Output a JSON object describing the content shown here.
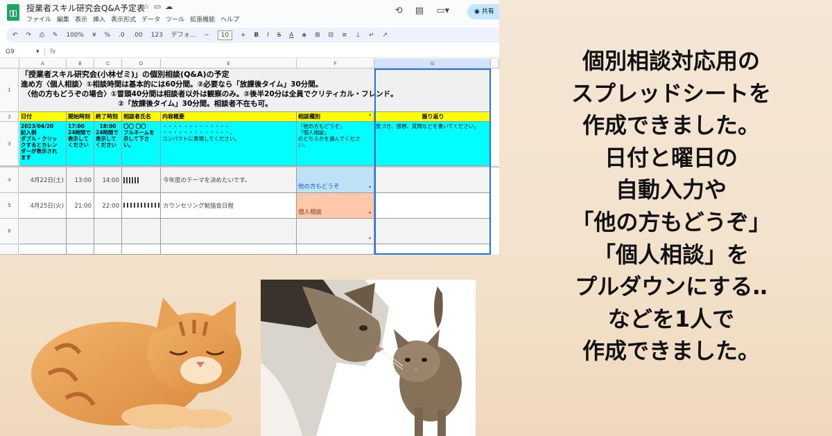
{
  "window": {
    "doc_title": "授業者スキル研究会Q&A予定表",
    "menu": [
      "ファイル",
      "編集",
      "表示",
      "挿入",
      "表示形式",
      "データ",
      "ツール",
      "拡張機能",
      "ヘルプ"
    ],
    "share_label": "共有"
  },
  "toolbar": {
    "zoom": "100%",
    "currency": "¥",
    "percent": "%",
    "dec_less": ".0",
    "dec_more": ".00",
    "number_format": "123",
    "font": "デフォ...",
    "font_size": "10"
  },
  "formula_bar": {
    "cell_ref": "G9",
    "fx": "fx"
  },
  "columns": [
    "A",
    "B",
    "C",
    "D",
    "E",
    "F",
    "G"
  ],
  "rows": [
    "1",
    "2",
    "3",
    "4",
    "5",
    "6"
  ],
  "row1": {
    "line1": "「授業者スキル研究会(小林ゼミ)」の個別相談(Q&A)の予定",
    "line2": "進め方〈個人相談〉①相談時間は基本的には60分間。②必要なら「放課後タイム」30分間。",
    "line3": "〈他の方もどうぞの場合〉①冒頭40分間は相談者以外は観察のみ。②後半20分は全員でクリティカル・フレンド。",
    "line4": "②「放課後タイム」30分間。相談者不在も可。"
  },
  "header_row": {
    "date": "日付",
    "start": "開始時刻",
    "end": "終了時刻",
    "name": "相談者氏名",
    "content": "内容概要",
    "type": "相談種別",
    "reflection": "振り返り"
  },
  "example_row": {
    "date_line1": "2023/04/20",
    "date_line2": "記入例",
    "date_line3": "ダブル・クリッ",
    "date_line4": "クするとカレン",
    "date_line5": "ダーが表示され",
    "date_line6": "ます",
    "start_line1": "17:00",
    "start_line2": "24時間で",
    "start_line3": "表示して",
    "start_line4": "ください",
    "end_line1": "18:00",
    "end_line2": "24時間で",
    "end_line3": "表示して",
    "end_line4": "ください",
    "name_line1": "〇〇 〇〇",
    "name_line2": "フルネームを",
    "name_line3": "示して下さ",
    "name_line4": "い。",
    "content_line1": "・・・・・・・・・・・・・",
    "content_line2": "・・・・・・・・・・・・・。",
    "content_line3": "コンパクトに表現してください。",
    "type_line1": "「他の方もどうぞ」",
    "type_line2": "「個人相談」",
    "type_line3": "のどちらかを選んでくださ",
    "type_line4": "い。",
    "reflection": "気づき、感想、質問などを書いてください。"
  },
  "data_rows": [
    {
      "date": "4月22日(土)",
      "start": "13:00",
      "end": "14:00",
      "content": "今年度のテーマを決めたいです。",
      "type": "他の方もどうぞ"
    },
    {
      "date": "4月25日(火)",
      "start": "21:00",
      "end": "22:00",
      "content": "カウンセリング勉強会日程",
      "type": "個人相談"
    }
  ],
  "caption": [
    "個別相談対応用の",
    "スプレッドシートを",
    "作成できました。",
    "日付と曜日の",
    "自動入力や",
    "「他の方もどうぞ」",
    "「個人相談」を",
    "プルダウンにする‥",
    "などを1人で",
    "作成できました。"
  ],
  "colors": {
    "header_yellow": "#ffff00",
    "example_cyan": "#00ffff",
    "chip_blue": "#bfe1f6",
    "chip_orange": "#ffc8aa",
    "selection_blue": "#1a73e8"
  }
}
